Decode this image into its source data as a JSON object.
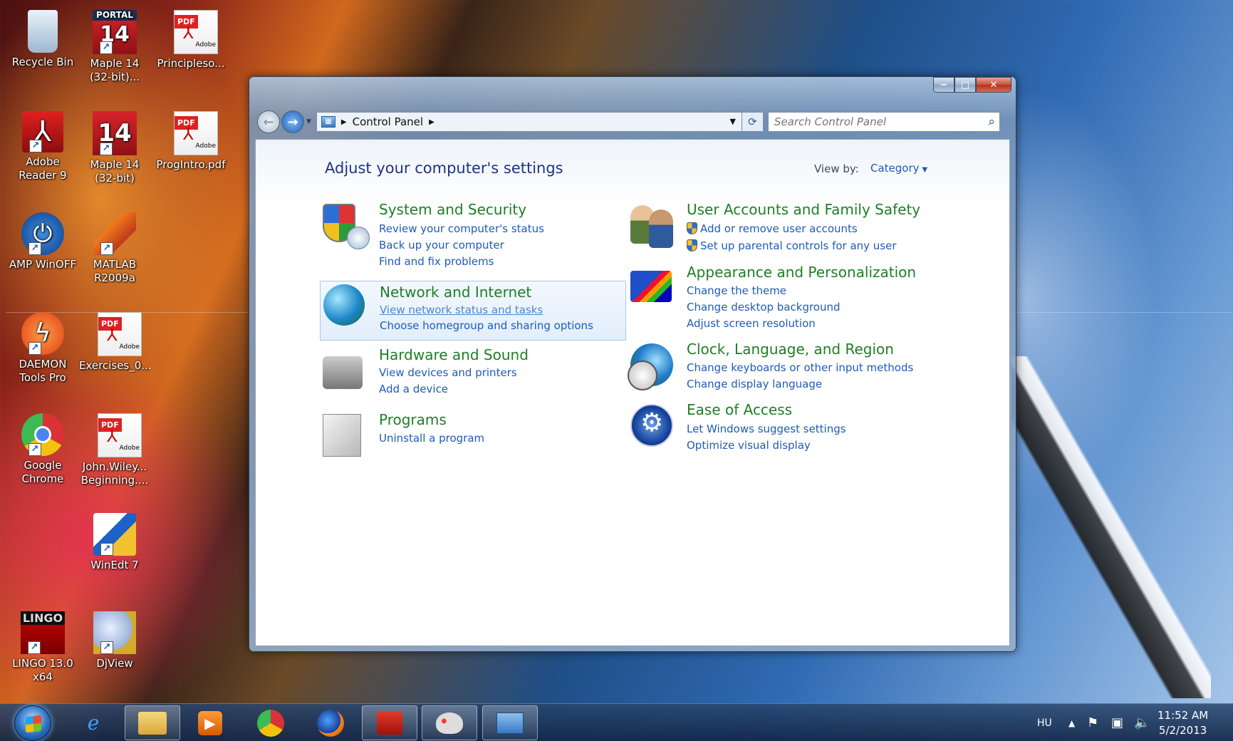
{
  "desktop": {
    "icons": [
      {
        "label1": "Recycle Bin",
        "label2": ""
      },
      {
        "label1": "Maple 14",
        "label2": "(32-bit)...",
        "badge": "PORTAL",
        "num": "14"
      },
      {
        "label1": "Principleso...",
        "label2": ""
      },
      {
        "label1": "Adobe",
        "label2": "Reader 9"
      },
      {
        "label1": "Maple 14",
        "label2": "(32-bit)",
        "num": "14"
      },
      {
        "label1": "ProgIntro.pdf",
        "label2": ""
      },
      {
        "label1": "AMP WinOFF",
        "label2": ""
      },
      {
        "label1": "MATLAB",
        "label2": "R2009a"
      },
      {
        "label1": "DAEMON",
        "label2": "Tools Pro"
      },
      {
        "label1": "Exercises_0...",
        "label2": ""
      },
      {
        "label1": "Google",
        "label2": "Chrome"
      },
      {
        "label1": "John.Wiley...",
        "label2": "Beginning...."
      },
      {
        "label1": "WinEdt 7",
        "label2": ""
      },
      {
        "label1": "LINGO 13.0",
        "label2": "x64",
        "badge": "LINGO"
      },
      {
        "label1": "DjView",
        "label2": ""
      }
    ],
    "pdf_tag": "PDF",
    "adobe_tag": "Adobe"
  },
  "window": {
    "caption": {
      "min": "−",
      "max": "□",
      "close": "✕"
    },
    "breadcrumb": "Control Panel",
    "search_placeholder": "Search Control Panel",
    "title": "Adjust your computer's settings",
    "view_by_label": "View by:",
    "view_by_value": "Category",
    "categories": [
      {
        "title": "System and Security",
        "links": [
          "Review your computer's status",
          "Back up your computer",
          "Find and fix problems"
        ]
      },
      {
        "title": "Network and Internet",
        "links": [
          "View network status and tasks",
          "Choose homegroup and sharing options"
        ]
      },
      {
        "title": "Hardware and Sound",
        "links": [
          "View devices and printers",
          "Add a device"
        ]
      },
      {
        "title": "Programs",
        "links": [
          "Uninstall a program"
        ]
      },
      {
        "title": "User Accounts and Family Safety",
        "links": [
          "Add or remove user accounts",
          "Set up parental controls for any user"
        ]
      },
      {
        "title": "Appearance and Personalization",
        "links": [
          "Change the theme",
          "Change desktop background",
          "Adjust screen resolution"
        ]
      },
      {
        "title": "Clock, Language, and Region",
        "links": [
          "Change keyboards or other input methods",
          "Change display language"
        ]
      },
      {
        "title": "Ease of Access",
        "links": [
          "Let Windows suggest settings",
          "Optimize visual display"
        ]
      }
    ]
  },
  "taskbar": {
    "language": "HU",
    "time": "11:52 AM",
    "date": "5/2/2013",
    "apps": [
      "internet-explorer",
      "windows-explorer",
      "media-player",
      "chrome",
      "firefox",
      "acrobat",
      "paint",
      "control-panel"
    ]
  },
  "colors": {
    "category_title": "#1e7f26",
    "link": "#1e5bb8",
    "page_title": "#1e3287"
  }
}
